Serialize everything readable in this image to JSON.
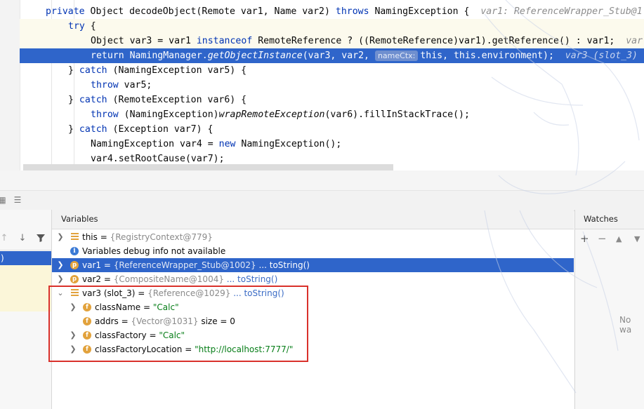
{
  "code": {
    "line1": {
      "kw_private": "private",
      "text1": " Object ",
      "method": "decodeObject",
      "text2": "(Remote var1, Name var2) ",
      "kw_throws": "throws",
      "text3": " NamingException {  ",
      "hint": "var1: ReferenceWrapper_Stub@1"
    },
    "line2": {
      "kw_try": "try",
      "text": " {"
    },
    "line3": {
      "text1": "Object var3 = var1 ",
      "kw_instanceof": "instanceof",
      "text2": " RemoteReference ? ((RemoteReference)var1).getReference() : var1;  ",
      "hint": "var"
    },
    "line4": {
      "kw_return": "return",
      "text1": " NamingManager.",
      "method": "getObjectInstance",
      "text2": "(var3, var2, ",
      "inlay": "nameCtx:",
      "text3": "this, this.environment);  ",
      "hint": "var3 (slot_3)"
    },
    "line5": {
      "text1": "} ",
      "kw_catch": "catch",
      "text2": " (NamingException var5) {"
    },
    "line6": {
      "kw_throw": "throw",
      "text": " var5;"
    },
    "line7": {
      "text1": "} ",
      "kw_catch": "catch",
      "text2": " (RemoteException var6) {"
    },
    "line8": {
      "kw_throw": "throw",
      "text1": " (NamingException)",
      "method": "wrapRemoteException",
      "text2": "(var6).fillInStackTrace();"
    },
    "line9": {
      "text1": "} ",
      "kw_catch": "catch",
      "text2": " (Exception var7) {"
    },
    "line10": {
      "text1": "NamingException var4 = ",
      "kw_new": "new",
      "text2": " NamingException();"
    },
    "line11": {
      "text": "var4.setRootCause(var7);"
    }
  },
  "frames": {
    "selected_text": ")"
  },
  "variables": {
    "title": "Variables",
    "rows": [
      {
        "name": "this",
        "eq": " = ",
        "value": "{RegistryContext@779}",
        "icon": "field-lines-icon"
      },
      {
        "info": "Variables debug info not available",
        "icon": "info-icon"
      },
      {
        "name": "var1",
        "eq": " = ",
        "value": "{ReferenceWrapper_Stub@1002}",
        "link": " ... toString()",
        "badge": "p"
      },
      {
        "name": "var2",
        "eq": " = ",
        "value": "{CompositeName@1004}",
        "link": " ... toString()",
        "badge": "p"
      },
      {
        "name": "var3 (slot_3)",
        "eq": " = ",
        "value": "{Reference@1029}",
        "link": " ... toString()",
        "icon": "field-lines-icon"
      },
      {
        "name": "className",
        "eq": " = ",
        "str": "\"Calc\"",
        "badge": "f"
      },
      {
        "name": "addrs",
        "eq": " = ",
        "value": "{Vector@1031}",
        "extra": "  size = 0",
        "badge": "f"
      },
      {
        "name": "classFactory",
        "eq": " = ",
        "str": "\"Calc\"",
        "badge": "f"
      },
      {
        "name": "classFactoryLocation",
        "eq": " = ",
        "str": "\"http://localhost:7777/\"",
        "badge": "f"
      }
    ]
  },
  "watches": {
    "title": "Watches",
    "empty": "No wa"
  },
  "colors": {
    "selection": "#2f65ca",
    "keyword": "#0033b3",
    "string": "#067d17",
    "highlight_box": "#d9312b"
  }
}
